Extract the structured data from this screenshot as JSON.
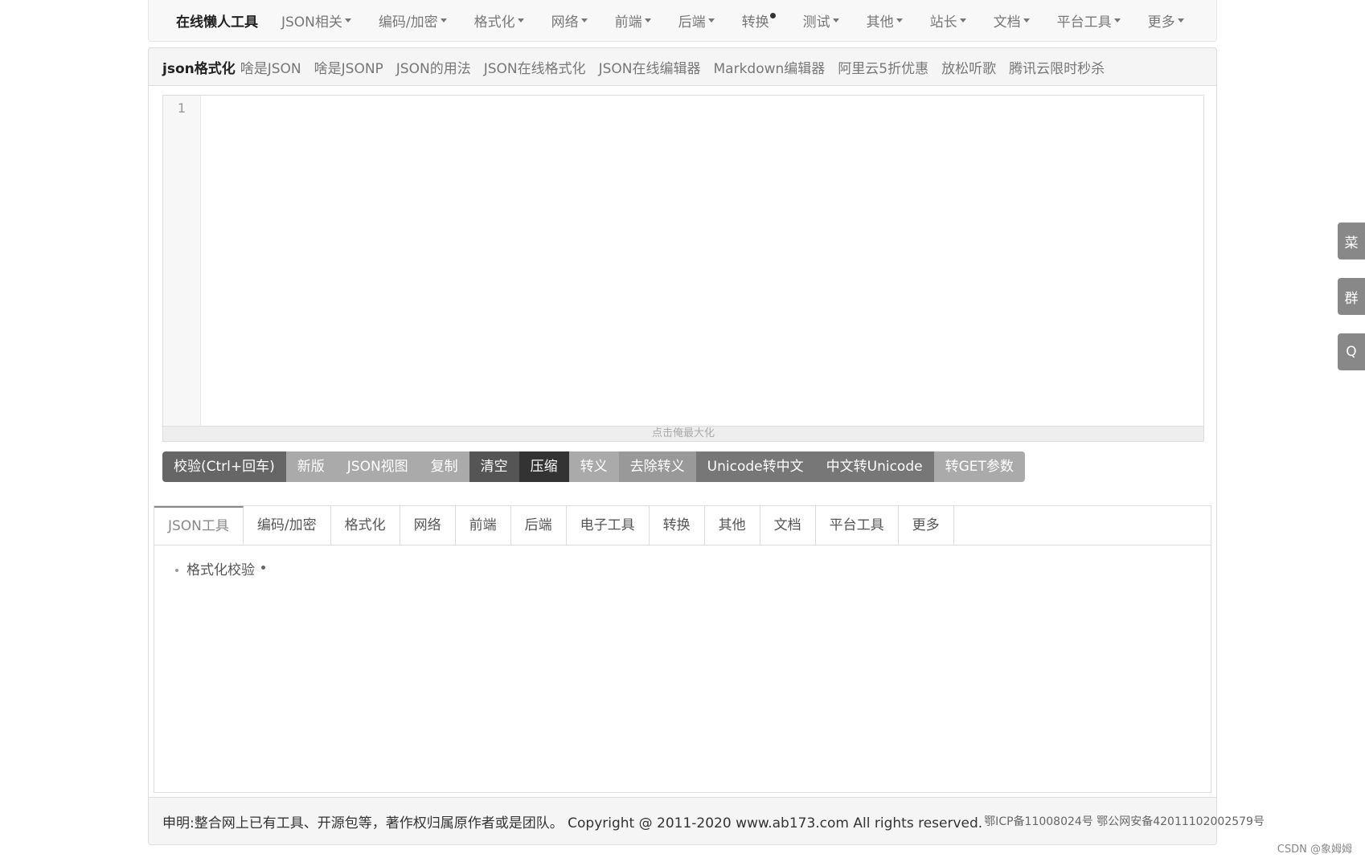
{
  "navbar": {
    "brand": "在线懒人工具",
    "items": [
      {
        "label": "JSON相关",
        "caret": true
      },
      {
        "label": "编码/加密",
        "caret": true
      },
      {
        "label": "格式化",
        "caret": true
      },
      {
        "label": "网络",
        "caret": true
      },
      {
        "label": "前端",
        "caret": true
      },
      {
        "label": "后端",
        "caret": true
      },
      {
        "label": "转换",
        "caret": false,
        "dot": true
      },
      {
        "label": "测试",
        "caret": true
      },
      {
        "label": "其他",
        "caret": true
      },
      {
        "label": "站长",
        "caret": true
      },
      {
        "label": "文档",
        "caret": true
      },
      {
        "label": "平台工具",
        "caret": true
      },
      {
        "label": "更多",
        "caret": true
      }
    ]
  },
  "linkbar": {
    "title": "json格式化",
    "links": [
      "啥是JSON",
      "啥是JSONP",
      "JSON的用法",
      "JSON在线格式化",
      "JSON在线编辑器",
      "Markdown编辑器",
      "阿里云5折优惠",
      "放松听歌",
      "腾讯云限时秒杀"
    ]
  },
  "editor": {
    "line_number": "1",
    "maximize_label": "点击俺最大化"
  },
  "buttons": [
    {
      "label": "校验(Ctrl+回车)",
      "color": "#666666"
    },
    {
      "label": "新版",
      "color": "#aaaaaa"
    },
    {
      "label": "JSON视图",
      "color": "#aaaaaa"
    },
    {
      "label": "复制",
      "color": "#aaaaaa"
    },
    {
      "label": "清空",
      "color": "#555555"
    },
    {
      "label": "压缩",
      "color": "#333333"
    },
    {
      "label": "转义",
      "color": "#aaaaaa"
    },
    {
      "label": "去除转义",
      "color": "#999999"
    },
    {
      "label": "Unicode转中文",
      "color": "#777777"
    },
    {
      "label": "中文转Unicode",
      "color": "#777777"
    },
    {
      "label": "转GET参数",
      "color": "#aaaaaa"
    }
  ],
  "tabs": {
    "items": [
      "JSON工具",
      "编码/加密",
      "格式化",
      "网络",
      "前端",
      "后端",
      "电子工具",
      "转换",
      "其他",
      "文档",
      "平台工具",
      "更多"
    ],
    "active_index": 0,
    "content_items": [
      "格式化校验"
    ]
  },
  "footer": {
    "text": "申明:整合网上已有工具、开源包等，著作权归属原作者或是团队。 Copyright @ 2011-2020 www.ab173.com All rights reserved.",
    "icp": "鄂ICP备11008024号 鄂公网安备42011102002579号"
  },
  "side_buttons": [
    "菜",
    "群",
    "Q"
  ],
  "watermark": "CSDN @象姆姆"
}
